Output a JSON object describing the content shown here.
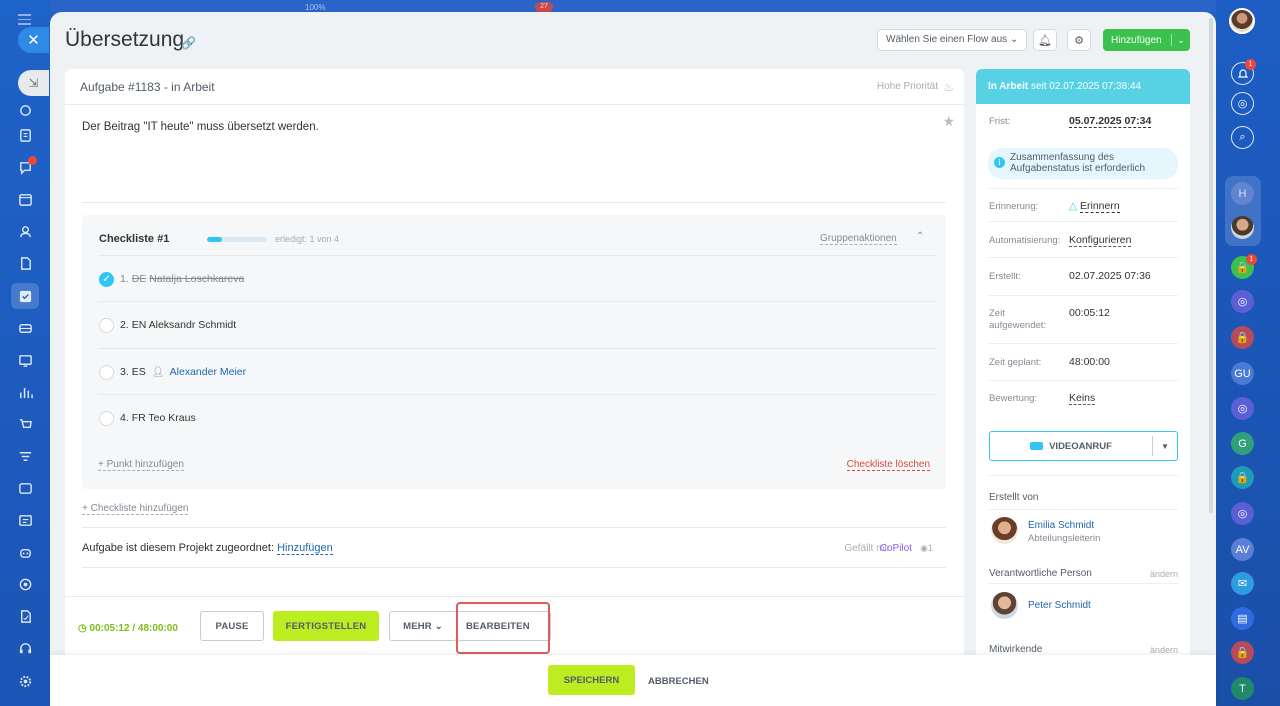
{
  "top": {
    "zoom": "100%",
    "badge": "27"
  },
  "task": {
    "title": "Übersetzung",
    "flow_placeholder": "Wählen Sie einen Flow aus",
    "add_label": "Hinzufügen",
    "header": "Aufgabe #1183 - in Arbeit",
    "priority": "Hohe Priorität",
    "description": "Der Beitrag \"IT heute\" muss übersetzt werden."
  },
  "checklist": {
    "title": "Checkliste #1",
    "done": "erledigt: 1 von 4",
    "progress": 0.25,
    "group_actions": "Gruppenaktionen",
    "items": [
      {
        "num": "1.",
        "lang": "DE",
        "name": "Natalja Loschkareva",
        "checked": true
      },
      {
        "num": "2.",
        "lang": "EN",
        "name": "Aleksandr Schmidt",
        "checked": false
      },
      {
        "num": "3.",
        "lang": "ES",
        "name": "Alexander Meier",
        "checked": false
      },
      {
        "num": "4.",
        "lang": "FR",
        "name": "Teo Kraus",
        "checked": false
      }
    ],
    "add_item": "+ Punkt hinzufügen",
    "delete": "Checkliste löschen"
  },
  "add_checklist": "+ Checkliste hinzufügen",
  "project": {
    "label": "Aufgabe ist diesem Projekt zugeordnet:",
    "link": "Hinzufügen",
    "likes": "Gefällt mir",
    "copilot": "CoPilot",
    "views": "1"
  },
  "footer": {
    "timer": "00:05:12 / 48:00:00",
    "pause": "PAUSE",
    "finish": "FERTIGSTELLEN",
    "more": "MEHR",
    "edit": "BEARBEITEN"
  },
  "status": {
    "head_state": "In Arbeit",
    "head_since": "seit 02.07.2025 07:38:44",
    "deadline_label": "Frist:",
    "deadline": "05.07.2025 07:34",
    "info": "Zusammenfassung des Aufgabenstatus ist erforderlich",
    "reminder_label": "Erinnerung:",
    "reminder": "Erinnern",
    "automation_label": "Automatisierung:",
    "automation": "Konfigurieren",
    "created_label": "Erstellt:",
    "created": "02.07.2025 07:36",
    "time_spent_label": "Zeit aufgewendet:",
    "time_spent": "00:05:12",
    "time_planned_label": "Zeit geplant:",
    "time_planned": "48:00:00",
    "rating_label": "Bewertung:",
    "rating": "Keins",
    "video_call": "VIDEOANRUF",
    "created_by_label": "Erstellt von",
    "creator_name": "Emilia Schmidt",
    "creator_role": "Abteilungsleiterin",
    "responsible_label": "Verantwortliche Person",
    "change": "ändern",
    "responsible_name": "Peter Schmidt",
    "participants_label": "Mitwirkende"
  },
  "bottom": {
    "save": "SPEICHERN",
    "cancel": "ABBRECHEN"
  },
  "right_sidebar": {
    "notif_badge": "1",
    "lock_badge": "1",
    "avatars": [
      "H",
      "GU",
      "G",
      "AV",
      "T"
    ]
  },
  "colors": {
    "accent_green": "#bbed21",
    "status_cyan": "#56d2e4",
    "link_blue": "#2067b0",
    "highlight_red": "#e05b5b"
  }
}
